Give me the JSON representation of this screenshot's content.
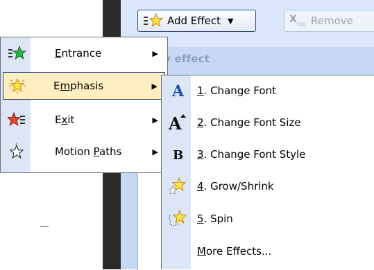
{
  "pane": {
    "title_fragment": "ify effect"
  },
  "toolbar": {
    "add_effect": {
      "label": "Add Effect",
      "icon": "add-effect-star-icon"
    },
    "remove": {
      "label": "Remove",
      "icon": "remove-x-icon",
      "enabled": false
    }
  },
  "main_menu": {
    "items": [
      {
        "label_pre": "",
        "accel": "E",
        "label_post": "ntrance",
        "icon": "green-star-icon",
        "has_submenu": true
      },
      {
        "label_pre": "E",
        "accel": "m",
        "label_post": "phasis",
        "icon": "yellow-star-icon",
        "has_submenu": true,
        "highlighted": true
      },
      {
        "label_pre": "E",
        "accel": "x",
        "label_post": "it",
        "icon": "red-star-icon",
        "has_submenu": true
      },
      {
        "label_pre": "Motion ",
        "accel": "P",
        "label_post": "aths",
        "icon": "outline-star-icon",
        "has_submenu": true
      }
    ]
  },
  "sub_menu": {
    "items": [
      {
        "accel": "1",
        "rest": ". Change Font",
        "icon": "font-a-icon"
      },
      {
        "accel": "2",
        "rest": ". Change Font Size",
        "icon": "font-size-a-icon"
      },
      {
        "accel": "3",
        "rest": ". Change Font Style",
        "icon": "bold-b-icon"
      },
      {
        "accel": "4",
        "rest": ". Grow/Shrink",
        "icon": "grow-star-icon"
      },
      {
        "accel": "5",
        "rest": ". Spin",
        "icon": "spin-star-icon"
      },
      {
        "accel": "M",
        "rest": "ore Effects...",
        "icon": ""
      }
    ]
  },
  "colors": {
    "highlight": "#ffeec0",
    "highlight_border": "#2b3f73",
    "gutter": "#dde6f7",
    "pane": "#c7d8f4"
  }
}
